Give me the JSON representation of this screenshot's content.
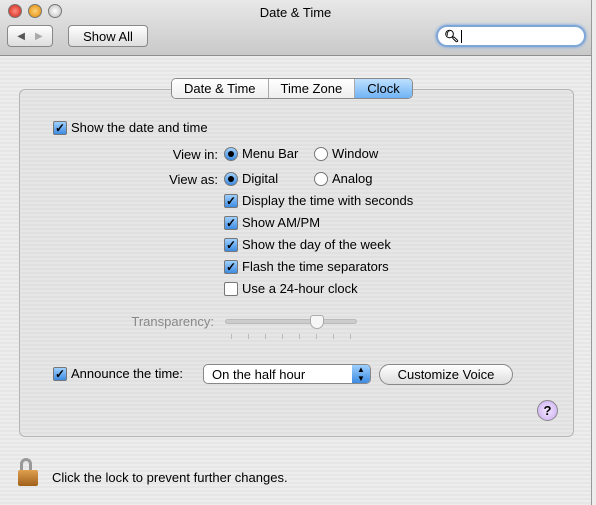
{
  "window": {
    "title": "Date & Time"
  },
  "toolbar": {
    "show_all": "Show All",
    "search_placeholder": ""
  },
  "tabs": [
    {
      "label": "Date & Time",
      "selected": false
    },
    {
      "label": "Time Zone",
      "selected": false
    },
    {
      "label": "Clock",
      "selected": true
    }
  ],
  "clock": {
    "show_date_time": {
      "label": "Show the date and time",
      "checked": true
    },
    "view_in": {
      "label": "View in:",
      "options": [
        "Menu Bar",
        "Window"
      ],
      "selected": "Menu Bar"
    },
    "view_as": {
      "label": "View as:",
      "options": [
        "Digital",
        "Analog"
      ],
      "selected": "Digital"
    },
    "options": [
      {
        "label": "Display the time with seconds",
        "checked": true
      },
      {
        "label": "Show AM/PM",
        "checked": true
      },
      {
        "label": "Show the day of the week",
        "checked": true
      },
      {
        "label": "Flash the time separators",
        "checked": true
      },
      {
        "label": "Use a 24-hour clock",
        "checked": false
      }
    ],
    "transparency": {
      "label": "Transparency:",
      "value_percent": 70,
      "enabled": false
    },
    "announce": {
      "label": "Announce the time:",
      "checked": true,
      "selected": "On the half hour",
      "customize": "Customize Voice"
    }
  },
  "help": "?",
  "lock_text": "Click the lock to prevent further changes.",
  "colors": {
    "accent": "#4a90e2"
  }
}
